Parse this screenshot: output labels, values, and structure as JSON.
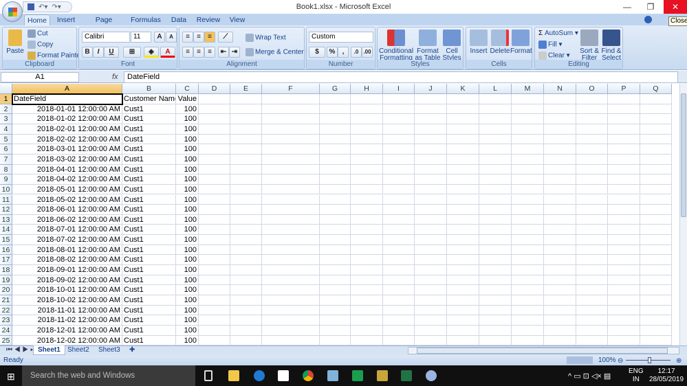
{
  "window": {
    "title": "Book1.xlsx - Microsoft Excel",
    "tooltip": "Close",
    "minimize_icon": "minimize-icon",
    "restore_icon": "restore-icon",
    "close_icon": "close-icon"
  },
  "tabs": [
    "Home",
    "Insert",
    "Page Layout",
    "Formulas",
    "Data",
    "Review",
    "View"
  ],
  "ribbon": {
    "clipboard": {
      "label": "Clipboard",
      "paste": "Paste",
      "cut": "Cut",
      "copy": "Copy",
      "format_painter": "Format Painter"
    },
    "font": {
      "label": "Font",
      "name": "Calibri",
      "size": "11",
      "bold": "B",
      "italic": "I",
      "underline": "U",
      "grow": "A",
      "shrink": "A",
      "color": "A"
    },
    "alignment": {
      "label": "Alignment",
      "wrap": "Wrap Text",
      "merge": "Merge & Center"
    },
    "number": {
      "label": "Number",
      "format": "Custom",
      "percent": "%",
      "comma": ",",
      "inc_dec": ".0",
      ".00": ".00"
    },
    "styles": {
      "label": "Styles",
      "conditional": "Conditional",
      "conditional2": "Formatting",
      "format_table": "Format",
      "format_table2": "as Table",
      "cell_styles": "Cell",
      "cell_styles2": "Styles"
    },
    "cells": {
      "label": "Cells",
      "insert": "Insert",
      "delete": "Delete",
      "format": "Format"
    },
    "editing": {
      "label": "Editing",
      "autosum": "AutoSum",
      "fill": "Fill",
      "clear": "Clear",
      "sort": "Sort &",
      "sort2": "Filter",
      "find": "Find &",
      "find2": "Select"
    }
  },
  "formula_bar": {
    "name_box": "A1",
    "fx": "fx",
    "value": "DateField"
  },
  "columns": [
    "A",
    "B",
    "C",
    "D",
    "E",
    "F",
    "G",
    "H",
    "I",
    "J",
    "K",
    "L",
    "M",
    "N",
    "O",
    "P",
    "Q"
  ],
  "header_row": [
    "DateField",
    "Customer Name",
    "Value"
  ],
  "rows": [
    [
      "2018-01-01 12:00:00 AM",
      "Cust1",
      "100"
    ],
    [
      "2018-01-02 12:00:00 AM",
      "Cust1",
      "100"
    ],
    [
      "2018-02-01 12:00:00 AM",
      "Cust1",
      "100"
    ],
    [
      "2018-02-02 12:00:00 AM",
      "Cust1",
      "100"
    ],
    [
      "2018-03-01 12:00:00 AM",
      "Cust1",
      "100"
    ],
    [
      "2018-03-02 12:00:00 AM",
      "Cust1",
      "100"
    ],
    [
      "2018-04-01 12:00:00 AM",
      "Cust1",
      "100"
    ],
    [
      "2018-04-02 12:00:00 AM",
      "Cust1",
      "100"
    ],
    [
      "2018-05-01 12:00:00 AM",
      "Cust1",
      "100"
    ],
    [
      "2018-05-02 12:00:00 AM",
      "Cust1",
      "100"
    ],
    [
      "2018-06-01 12:00:00 AM",
      "Cust1",
      "100"
    ],
    [
      "2018-06-02 12:00:00 AM",
      "Cust1",
      "100"
    ],
    [
      "2018-07-01 12:00:00 AM",
      "Cust1",
      "100"
    ],
    [
      "2018-07-02 12:00:00 AM",
      "Cust1",
      "100"
    ],
    [
      "2018-08-01 12:00:00 AM",
      "Cust1",
      "100"
    ],
    [
      "2018-08-02 12:00:00 AM",
      "Cust1",
      "100"
    ],
    [
      "2018-09-01 12:00:00 AM",
      "Cust1",
      "100"
    ],
    [
      "2018-09-02 12:00:00 AM",
      "Cust1",
      "100"
    ],
    [
      "2018-10-01 12:00:00 AM",
      "Cust1",
      "100"
    ],
    [
      "2018-10-02 12:00:00 AM",
      "Cust1",
      "100"
    ],
    [
      "2018-11-01 12:00:00 AM",
      "Cust1",
      "100"
    ],
    [
      "2018-11-02 12:00:00 AM",
      "Cust1",
      "100"
    ],
    [
      "2018-12-01 12:00:00 AM",
      "Cust1",
      "100"
    ],
    [
      "2018-12-02 12:00:00 AM",
      "Cust1",
      "100"
    ]
  ],
  "sheets": [
    "Sheet1",
    "Sheet2",
    "Sheet3"
  ],
  "status": {
    "text": "Ready",
    "zoom": "100%"
  },
  "taskbar": {
    "search": "Search the web and Windows",
    "lang": "ENG",
    "lang2": "IN",
    "time": "12:17",
    "date": "28/05/2019"
  }
}
